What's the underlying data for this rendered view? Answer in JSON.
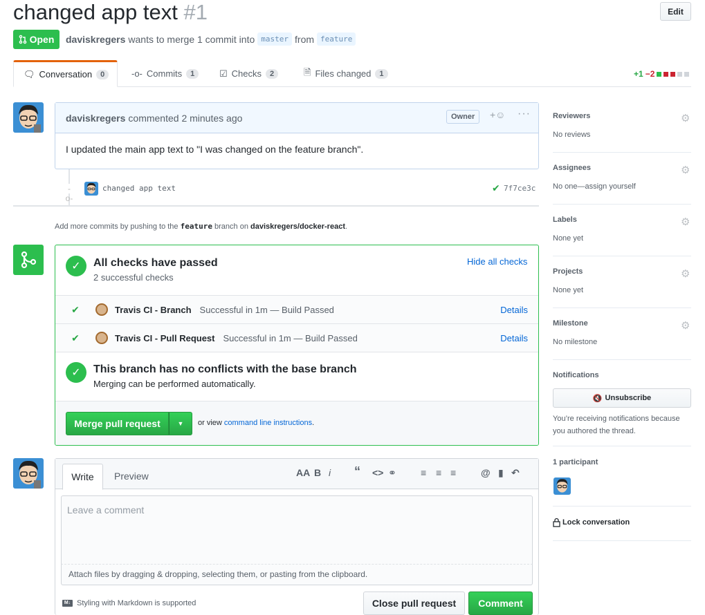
{
  "header": {
    "title": "changed app text",
    "number": "#1",
    "edit_label": "Edit",
    "state": "Open",
    "author": "daviskregers",
    "meta_text": "wants to merge 1 commit into",
    "base_branch": "master",
    "from_text": "from",
    "head_branch": "feature"
  },
  "tabs": [
    {
      "label": "Conversation",
      "count": "0"
    },
    {
      "label": "Commits",
      "count": "1"
    },
    {
      "label": "Checks",
      "count": "2"
    },
    {
      "label": "Files changed",
      "count": "1"
    }
  ],
  "diffstat": {
    "additions": "+1",
    "deletions": "−2"
  },
  "comment": {
    "author": "daviskregers",
    "meta": "commented 2 minutes ago",
    "badge": "Owner",
    "body": "I updated the main app text to \"I was changed on the feature branch\"."
  },
  "commit": {
    "message": "changed app text",
    "sha": "7f7ce3c"
  },
  "push_hint": {
    "prefix": "Add more commits by pushing to the",
    "branch": "feature",
    "middle": "branch on",
    "repo": "daviskregers/docker-react",
    "suffix": "."
  },
  "checks": {
    "title": "All checks have passed",
    "subtitle": "2 successful checks",
    "hide_label": "Hide all checks",
    "rows": [
      {
        "name": "Travis CI - Branch",
        "desc": "Successful in 1m — Build Passed",
        "details": "Details"
      },
      {
        "name": "Travis CI - Pull Request",
        "desc": "Successful in 1m — Build Passed",
        "details": "Details"
      }
    ],
    "conflict_title": "This branch has no conflicts with the base branch",
    "conflict_sub": "Merging can be performed automatically."
  },
  "merge": {
    "button": "Merge pull request",
    "alt_prefix": "or view",
    "alt_link": "command line instructions",
    "alt_suffix": "."
  },
  "new_comment": {
    "tab_write": "Write",
    "tab_preview": "Preview",
    "placeholder": "Leave a comment",
    "attach": "Attach files by dragging & dropping, selecting them, or pasting from the clipboard.",
    "markdown": "Styling with Markdown is supported",
    "close_button": "Close pull request",
    "comment_button": "Comment"
  },
  "sidebar": {
    "reviewers": {
      "label": "Reviewers",
      "value": "No reviews"
    },
    "assignees": {
      "label": "Assignees",
      "value": "No one—assign yourself"
    },
    "labels": {
      "label": "Labels",
      "value": "None yet"
    },
    "projects": {
      "label": "Projects",
      "value": "None yet"
    },
    "milestone": {
      "label": "Milestone",
      "value": "No milestone"
    },
    "notifications": {
      "label": "Notifications",
      "button": "Unsubscribe",
      "text": "You’re receiving notifications because you authored the thread."
    },
    "participants": "1 participant",
    "lock": "Lock conversation"
  },
  "colors": {
    "green": "#2cbe4e",
    "blue": "#0366d6",
    "red": "#cb2431"
  }
}
